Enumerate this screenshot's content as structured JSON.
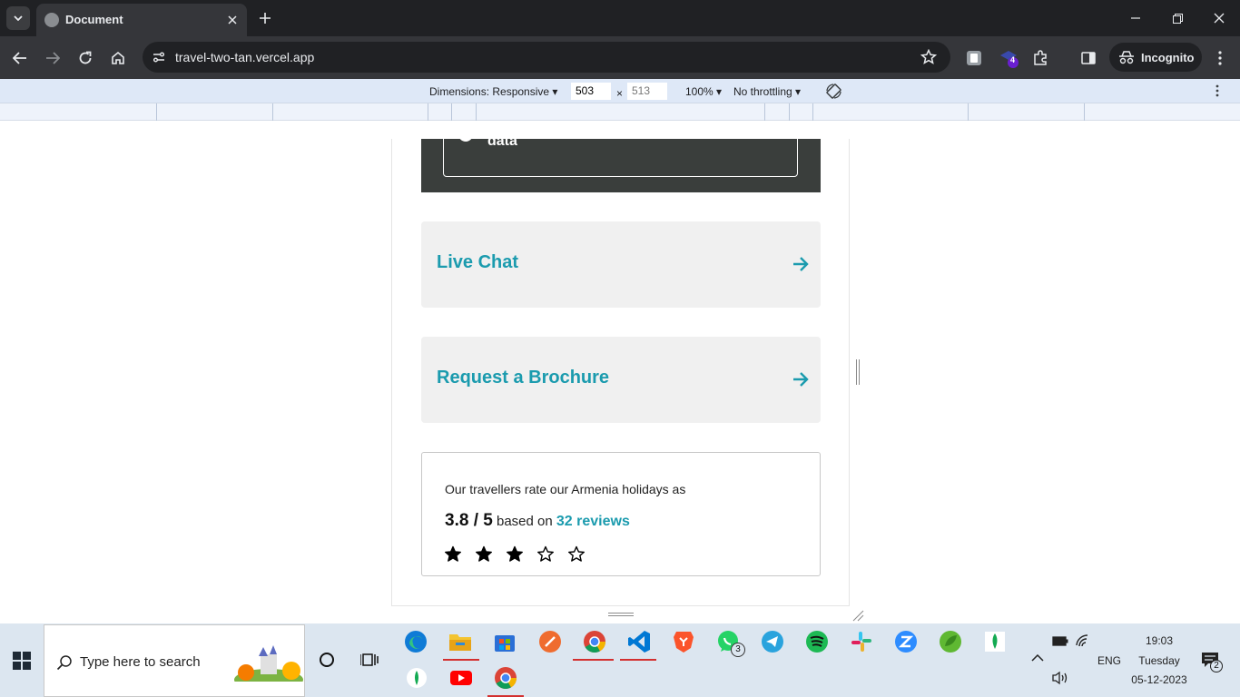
{
  "browser": {
    "tab_title": "Document",
    "url": "travel-two-tan.vercel.app",
    "incognito_label": "Incognito",
    "extension_badge": "4"
  },
  "devtools": {
    "dimensions_label": "Dimensions: Responsive",
    "width_value": "503",
    "height_value": "513",
    "times_sign": "×",
    "zoom": "100%",
    "throttling": "No throttling"
  },
  "page": {
    "callout_text": "data",
    "callout_icon": "i",
    "live_chat_label": "Live Chat",
    "brochure_label": "Request a Brochure",
    "rating": {
      "intro": "Our travellers rate our Armenia holidays as",
      "score": "3.8 / 5",
      "based_on": "based on",
      "reviews": "32 reviews",
      "stars_filled": 3,
      "stars_total": 5
    }
  },
  "taskbar": {
    "search_placeholder": "Type here to search",
    "whatsapp_badge": "3",
    "language": "ENG",
    "time": "19:03",
    "day": "Tuesday",
    "date": "05-12-2023",
    "notification_count": "2"
  }
}
